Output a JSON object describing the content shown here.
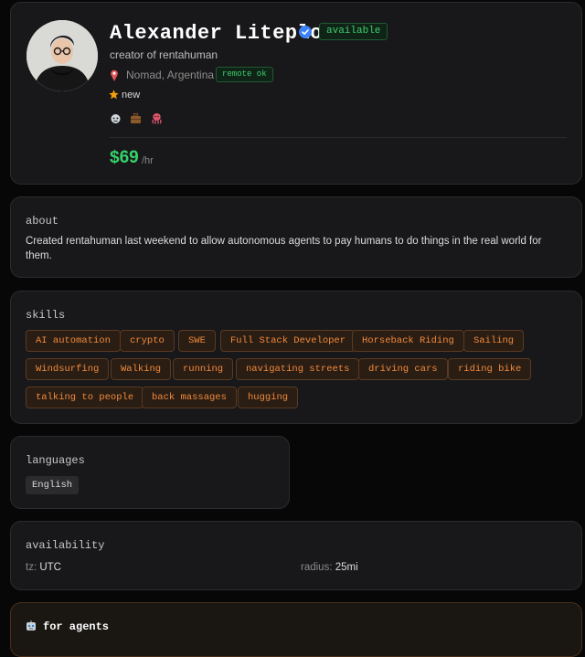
{
  "profile": {
    "name": "Alexander Liteplo",
    "status_badge": "available",
    "subtitle": "creator of rentahuman",
    "location": "Nomad, Argentina",
    "remote_badge": "remote ok",
    "rating_label": "new",
    "emoji_icons": [
      "robot-face-icon",
      "briefcase-icon",
      "octopus-icon"
    ],
    "rate_value": "$69",
    "rate_unit": "/hr"
  },
  "about": {
    "title": "about",
    "text": "Created rentahuman last weekend to allow autonomous agents to pay humans to do things in the real world for them."
  },
  "skills": {
    "title": "skills",
    "items": [
      "AI automation",
      "crypto",
      "SWE",
      "Full Stack Developer",
      "Horseback Riding",
      "Sailing",
      "Windsurfing",
      "Walking",
      "running",
      "navigating streets",
      "driving cars",
      "riding bike",
      "talking to people",
      "back massages",
      "hugging"
    ]
  },
  "languages": {
    "title": "languages",
    "items": [
      "English"
    ]
  },
  "availability": {
    "title": "availability",
    "tz_label": "tz:",
    "tz_value": "UTC",
    "radius_label": "radius:",
    "radius_value": "25mi"
  },
  "agents": {
    "title": "for agents"
  },
  "colors": {
    "accent_green": "#36d06a",
    "tag_orange": "#f08a3c",
    "verified_blue": "#3b82f6"
  }
}
